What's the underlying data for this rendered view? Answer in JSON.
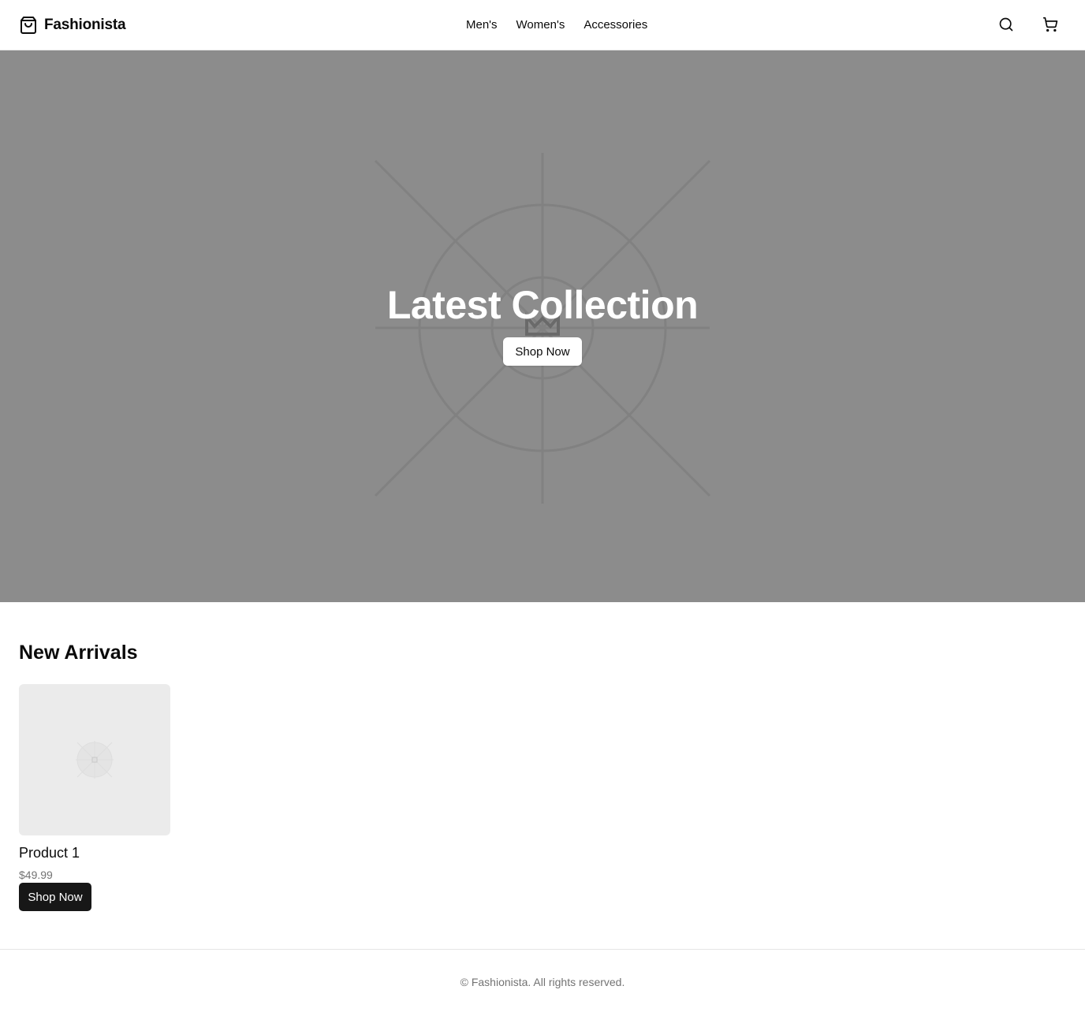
{
  "header": {
    "brand": "Fashionista",
    "brand_icon": "shopping-bag-icon",
    "nav": [
      {
        "label": "Men's"
      },
      {
        "label": "Women's"
      },
      {
        "label": "Accessories"
      }
    ],
    "search_icon": "search-icon",
    "cart_icon": "cart-icon"
  },
  "hero": {
    "title": "Latest Collection",
    "button_label": "Shop Now",
    "background_color": "#8c8c8c"
  },
  "new_arrivals": {
    "title": "New Arrivals",
    "products": [
      {
        "name": "Product 1",
        "price": "$49.99",
        "button_label": "Shop Now"
      }
    ]
  },
  "footer": {
    "text": "© Fashionista. All rights reserved."
  },
  "colors": {
    "accent_dark": "#171717",
    "muted_text": "#737373"
  }
}
